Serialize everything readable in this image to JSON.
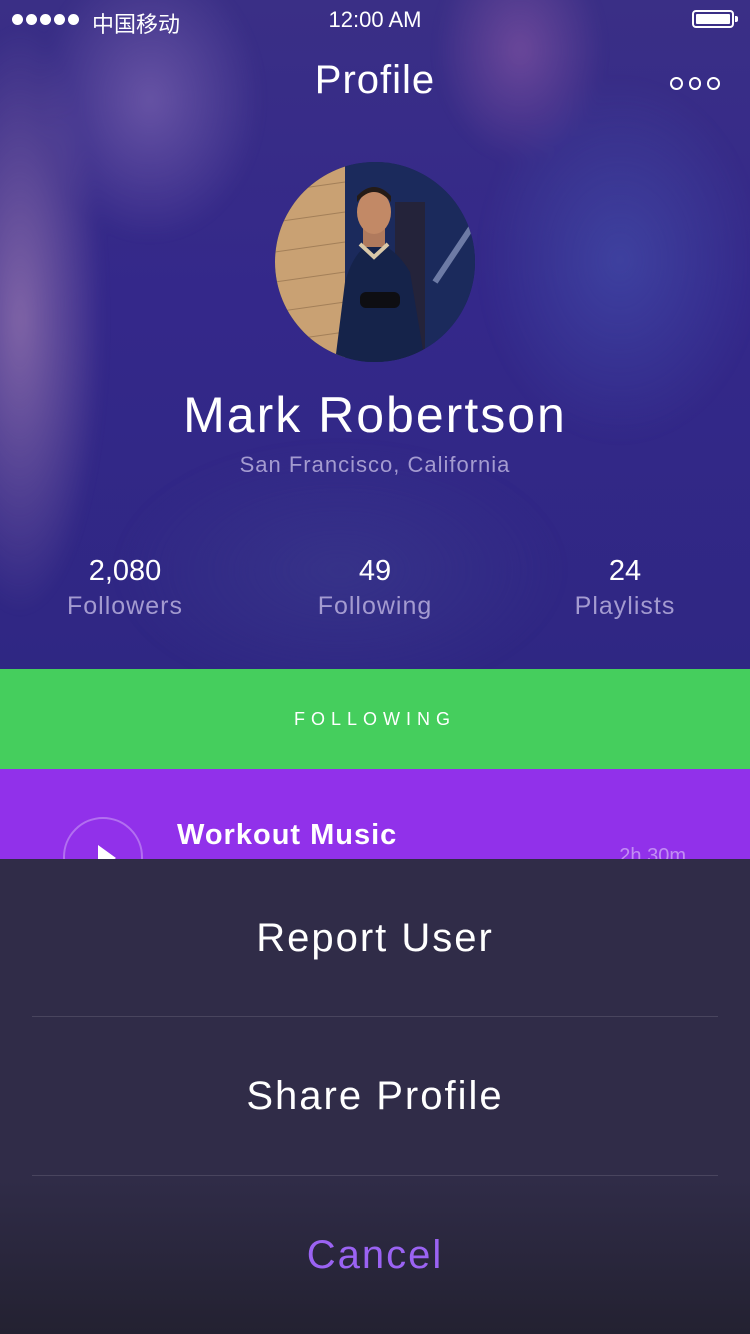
{
  "status_bar": {
    "carrier": "中国移动",
    "time": "12:00 AM"
  },
  "header": {
    "title": "Profile",
    "more_icon": "more-dots-icon"
  },
  "profile": {
    "name": "Mark Robertson",
    "location": "San Francisco, California",
    "avatar_alt": "profile photo"
  },
  "stats": [
    {
      "value": "2,080",
      "label": "Followers"
    },
    {
      "value": "49",
      "label": "Following"
    },
    {
      "value": "24",
      "label": "Playlists"
    }
  ],
  "follow_button": {
    "label": "FOLLOWING"
  },
  "playlist": {
    "title": "Workout Music",
    "duration": "2h 30m",
    "play_icon": "play-icon"
  },
  "action_sheet": {
    "items": [
      "Report User",
      "Share Profile"
    ],
    "cancel": "Cancel"
  },
  "colors": {
    "follow_green": "#45ce5d",
    "playlist_purple": "#9131ea",
    "cancel_purple": "#9b63f3",
    "sheet_bg": "#302c48"
  }
}
